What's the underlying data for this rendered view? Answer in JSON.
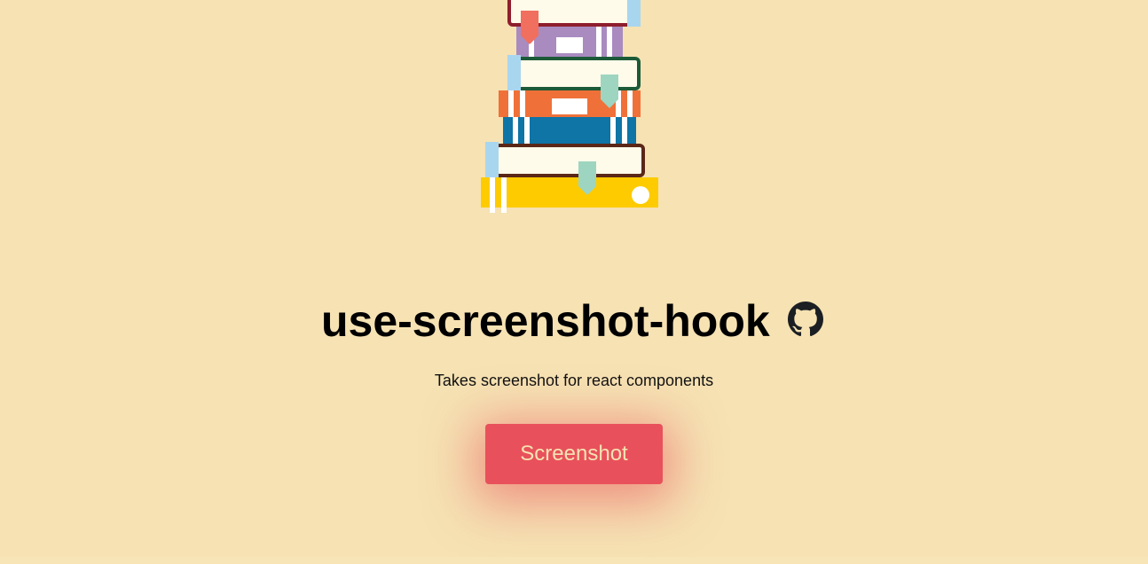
{
  "header": {
    "title": "use-screenshot-hook",
    "subtitle": "Takes screenshot for react components"
  },
  "github_link": {
    "icon": "github-icon"
  },
  "actions": {
    "screenshot_label": "Screenshot"
  },
  "illustration": {
    "icon": "book-stack-illustration"
  },
  "colors": {
    "background": "#f6e2b3",
    "button": "#e8515b",
    "button_text": "#f6e2b3",
    "title_text": "#000000"
  }
}
